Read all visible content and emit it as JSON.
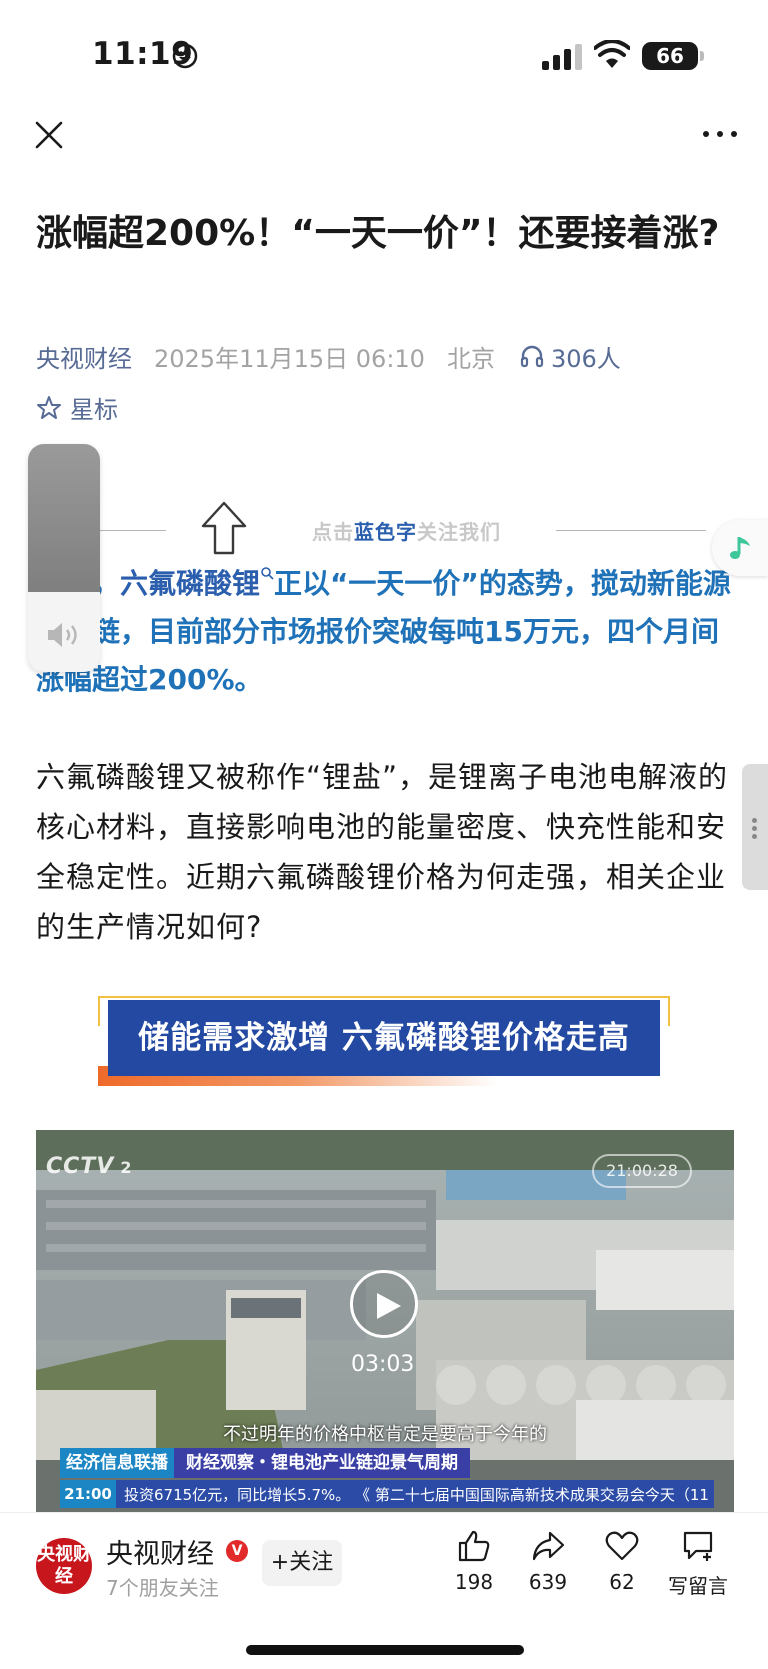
{
  "status_bar": {
    "time": "11:19",
    "battery": "66"
  },
  "article": {
    "title": "涨幅超200%！“一天一价”！还要接着涨?",
    "source": "央视财经",
    "date": "2025年11月15日 06:10",
    "location": "北京",
    "listeners": "306人",
    "star_label": "星标"
  },
  "follow_banner": {
    "prefix": "点击",
    "highlight": "蓝色字",
    "suffix": "关注我们"
  },
  "lead": {
    "part1": "近期，",
    "keyword": "六氟磷酸锂",
    "part2": "正以“一天一价”的态势，搅动新能源产业链，目前部分市场报价突破每吨15万元，四个月间涨幅超过200%。"
  },
  "body_paragraph": "六氟磷酸锂又被称作“锂盐”，是锂离子电池电解液的核心材料，直接影响电池的能量密度、快充性能和安全稳定性。近期六氟磷酸锂价格为何走强，相关企业的生产情况如何?",
  "section_header": "储能需求激增 六氟磷酸锂价格走高",
  "video": {
    "channel_logo": "CCTV",
    "channel_num": "2",
    "clock": "21:00:28",
    "duration": "03:03",
    "subtitle": "不过明年的价格中枢肯定是要高于今年的",
    "program": "经济信息联播",
    "segment": "财经观察・锂电池产业链迎景气周期",
    "ticker_time": "21:00",
    "ticker_text": "投资6715亿元，同比增长5.7%。    《  第二十七届中国国际高新技术成果交易会今天（11"
  },
  "bottom_bar": {
    "avatar_text": "央视财经",
    "account_name": "央视财经",
    "badge": "V",
    "friends": "7个朋友关注",
    "follow": "+关注",
    "likes": "198",
    "shares": "639",
    "favorites": "62",
    "comment": "写留言"
  },
  "colors": {
    "link": "#576b95",
    "lead": "#1f72b8",
    "section_bg": "#2449a2",
    "accent_orange": "#ee6a2a"
  },
  "icons": [
    "close-icon",
    "more-icon",
    "headphones-icon",
    "star-icon",
    "up-arrow-icon",
    "play-icon",
    "volume-icon",
    "music-note-icon",
    "thumbs-up-icon",
    "share-icon",
    "heart-icon",
    "comment-icon"
  ]
}
